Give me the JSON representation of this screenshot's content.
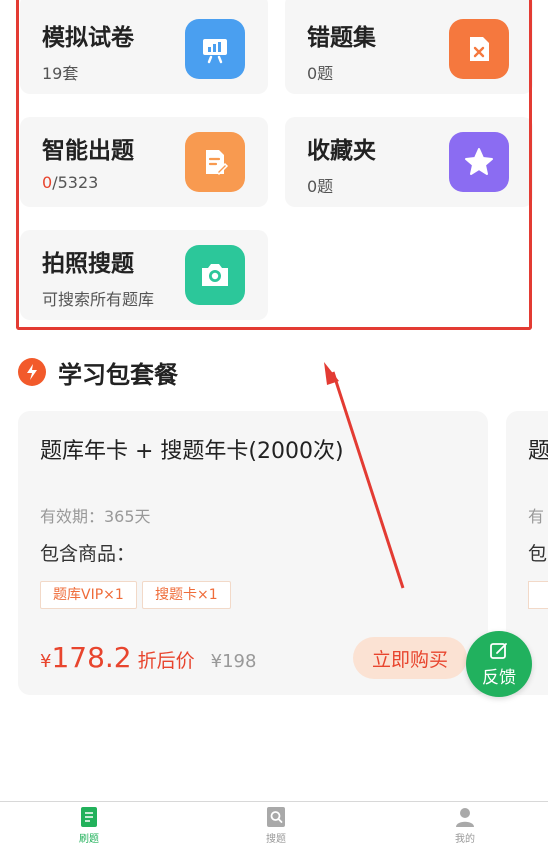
{
  "features": [
    {
      "title": "模拟试卷",
      "sub": "19套",
      "icon": "chart-board-icon",
      "color": "#4a9ff0"
    },
    {
      "title": "错题集",
      "sub": "0题",
      "icon": "error-doc-icon",
      "color": "#f5783e"
    },
    {
      "title": "智能出题",
      "sub_highlight": "0",
      "sub_rest": "/5323",
      "icon": "edit-doc-icon",
      "color": "#f89a50"
    },
    {
      "title": "收藏夹",
      "sub": "0题",
      "icon": "star-icon",
      "color": "#8b6cf2"
    },
    {
      "title": "拍照搜题",
      "sub": "可搜索所有题库",
      "icon": "camera-icon",
      "color": "#2cc79a"
    }
  ],
  "section": {
    "title": "学习包套餐",
    "icon": "lightning-icon"
  },
  "package": {
    "title": "题库年卡 + 搜题年卡(2000次)",
    "validity": "有效期：365天",
    "contains_label": "包含商品：",
    "tags": [
      "题库VIP×1",
      "搜题卡×1"
    ],
    "currency": "¥",
    "price": "178.2",
    "price_label": "折后价",
    "original_price": "¥198",
    "buy_label": "立即购买"
  },
  "package_next_peek": {
    "title_char": "题",
    "validity_char": "有",
    "contains_char": "包"
  },
  "feedback": {
    "label": "反馈",
    "icon": "feedback-edit-icon"
  },
  "nav": [
    {
      "label": "刷题",
      "icon": "practice-icon",
      "active": true
    },
    {
      "label": "搜题",
      "icon": "search-question-icon",
      "active": false
    },
    {
      "label": "我的",
      "icon": "profile-icon",
      "active": false
    }
  ],
  "colors": {
    "accent_green": "#21b15e",
    "price_red": "#e8452e",
    "highlight_red": "#e33b33"
  }
}
